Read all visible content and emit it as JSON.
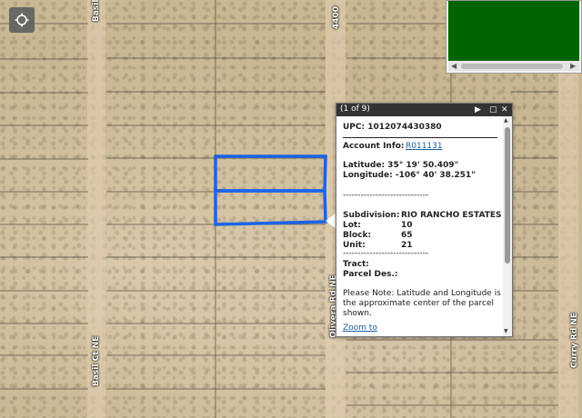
{
  "map": {
    "road_labels": {
      "basil_top": "Basil",
      "basil_bottom": "Basil Ct NE",
      "number_top": "4400",
      "olivera": "Olivera Rd NE",
      "curry": "Curry Rd NE"
    },
    "parcel_color": "#1a64e6"
  },
  "controls": {
    "locate_icon": "locate-icon"
  },
  "overview": {
    "map_color": "#006400"
  },
  "popup": {
    "count": "(1 of 9)",
    "upc": "UPC: 1012074430380",
    "account_label": "Account Info:",
    "account_value": "R011131",
    "latitude": "Latitude: 35° 19' 50.409\"",
    "longitude": "Longitude: -106° 40' 38.251\"",
    "separator": "-----------------------------",
    "subdivision_label": "Subdivision:",
    "subdivision_value": "RIO RANCHO ESTATES",
    "lot_label": "Lot:",
    "lot_value": "10",
    "block_label": "Block:",
    "block_value": "65",
    "unit_label": "Unit:",
    "unit_value": "21",
    "tract_label": "Tract:",
    "parcel_label": "Parcel Des.:",
    "note": [
      "Please Note: Latitude and Longitude is",
      "the approximate center of the parcel",
      "shown."
    ],
    "zoom_to": "Zoom to"
  }
}
